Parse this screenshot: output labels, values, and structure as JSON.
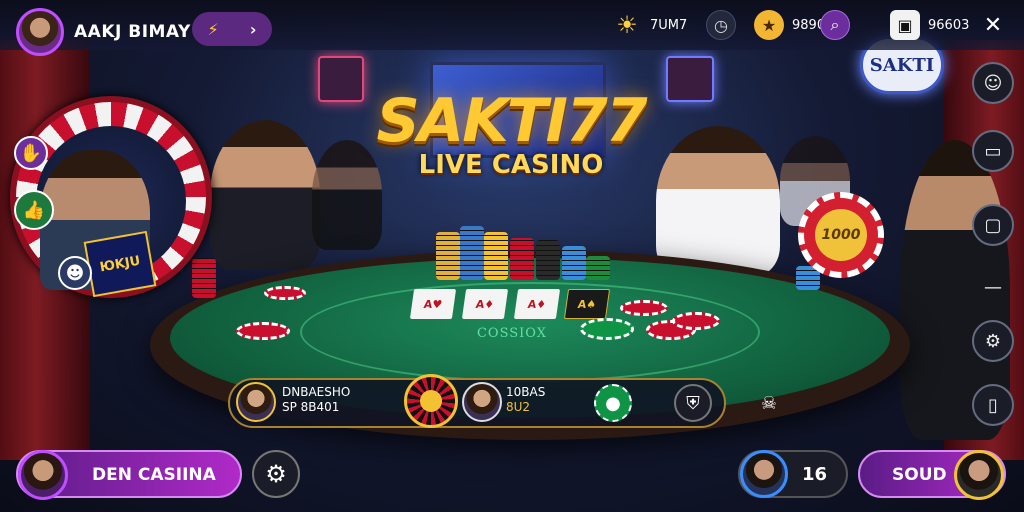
{
  "player": {
    "name": "AAKJ BIMAY"
  },
  "nav_pill": {
    "left_icon": "bolt-icon",
    "right_icon": "chevron-right-icon"
  },
  "hud": {
    "sun_value": "7UM7",
    "coin_value": "9890",
    "wallet_value": "96603"
  },
  "logo": {
    "title": "SAKTI77",
    "subtitle": "LIVE CASINO"
  },
  "brand_sign": "SAKTI",
  "table": {
    "felt_label": "COSSIOX",
    "cards": [
      "A♥",
      "A♦",
      "A♦",
      "A♠"
    ]
  },
  "big_chip_label": "1000",
  "wheel_card": "ЮKJU",
  "player_bar": {
    "p1_name": "DNBAESHO",
    "p1_value": "SP 8B401",
    "p2_name": "10BAS",
    "p2_value": "8U2"
  },
  "bottom": {
    "casino_label": "DEN CASIINA",
    "bet_label": "16",
    "sound_label": "SOUD"
  },
  "colors": {
    "accent_purple": "#b02ac8",
    "gold": "#ffc933",
    "felt_green": "#1d8a5a"
  }
}
